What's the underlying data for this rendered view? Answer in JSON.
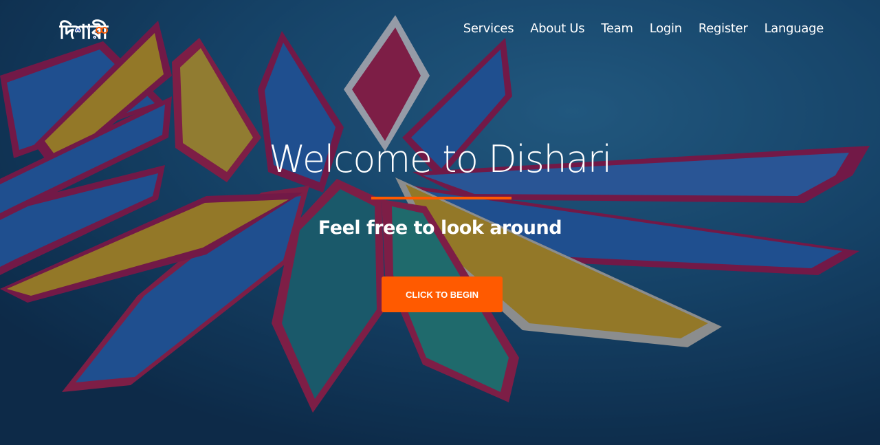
{
  "navbar": {
    "logo_text": "দিশারী",
    "links": [
      {
        "label": "Services"
      },
      {
        "label": "About Us"
      },
      {
        "label": "Team"
      },
      {
        "label": "Login"
      },
      {
        "label": "Register"
      },
      {
        "label": "Language"
      }
    ]
  },
  "hero": {
    "title": "Welcome to Dishari",
    "subtitle": "Feel free to look around",
    "cta_label": "CLICK TO BEGIN",
    "background_image": "colorful-boats-on-water"
  },
  "colors": {
    "accent": "#ff5a00",
    "text": "#ffffff",
    "logo_blue": "#1e3fa8",
    "logo_orange": "#ff5a00"
  }
}
